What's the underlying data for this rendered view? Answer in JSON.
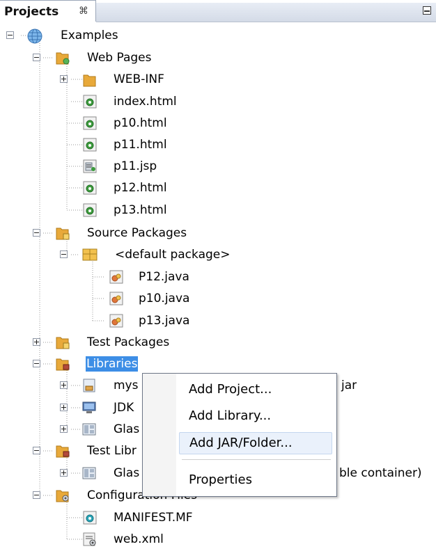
{
  "panel": {
    "title": "Projects",
    "close_glyph": "⌘"
  },
  "tree": {
    "project": "Examples",
    "web_pages": {
      "label": "Web Pages",
      "children": [
        "WEB-INF",
        "index.html",
        "p10.html",
        "p11.html",
        "p11.jsp",
        "p12.html",
        "p13.html"
      ]
    },
    "source_packages": {
      "label": "Source Packages",
      "default_package": "<default package>",
      "files": [
        "P12.java",
        "p10.java",
        "p13.java"
      ]
    },
    "test_packages": "Test Packages",
    "libraries": {
      "label": "Libraries",
      "children": [
        "mys",
        "JDK",
        "Glas"
      ],
      "suffix": "jar"
    },
    "test_libraries": {
      "label": "Test Libr",
      "children": [
        "Glas"
      ],
      "suffix": "ble container)"
    },
    "config_files": {
      "label": "Configuration Files",
      "children": [
        "MANIFEST.MF",
        "web.xml"
      ]
    }
  },
  "context_menu": {
    "items": [
      "Add Project...",
      "Add Library...",
      "Add JAR/Folder...",
      "Properties"
    ],
    "highlighted": "Add JAR/Folder..."
  },
  "colors": {
    "selection": "#3d8ee6",
    "folder": "#e8a93a",
    "file_green": "#3d9b3d"
  }
}
